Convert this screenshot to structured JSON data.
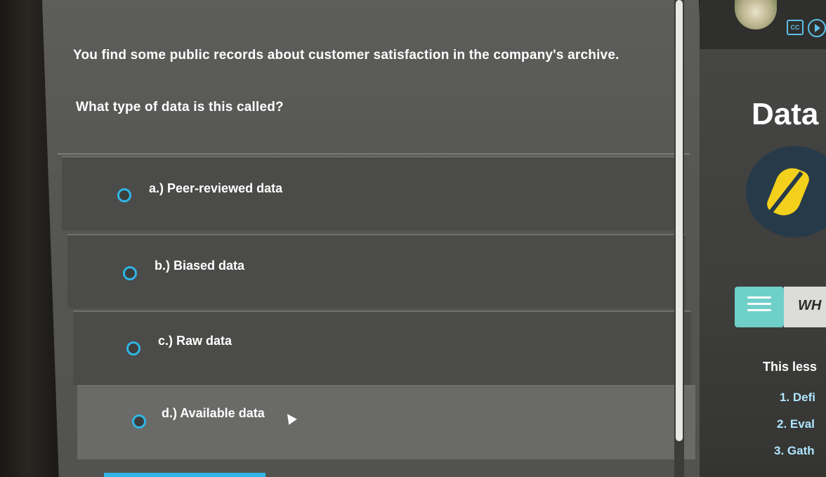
{
  "question": {
    "prompt": "You find some public records about customer satisfaction in the company's archive.",
    "question": "What type of data is this called?"
  },
  "options": [
    {
      "label": "a.) Peer-reviewed data",
      "selected": false
    },
    {
      "label": "b.) Biased data",
      "selected": false
    },
    {
      "label": "c.) Raw data",
      "selected": false
    },
    {
      "label": "d.) Available data",
      "selected": true
    }
  ],
  "side_panel": {
    "title": "Data",
    "cc_label": "CC",
    "tab_label": "WH",
    "intro": "This less",
    "items": [
      "1. Defi",
      "2. Eval",
      "3. Gath"
    ]
  },
  "colors": {
    "accent": "#2fb6e6",
    "badge_bg": "#273a4a",
    "badge_mark": "#f3d01c",
    "list_button": "#6fcfc9"
  },
  "icons": [
    "cc-icon",
    "play-icon",
    "list-icon",
    "mouse-cursor-icon"
  ]
}
